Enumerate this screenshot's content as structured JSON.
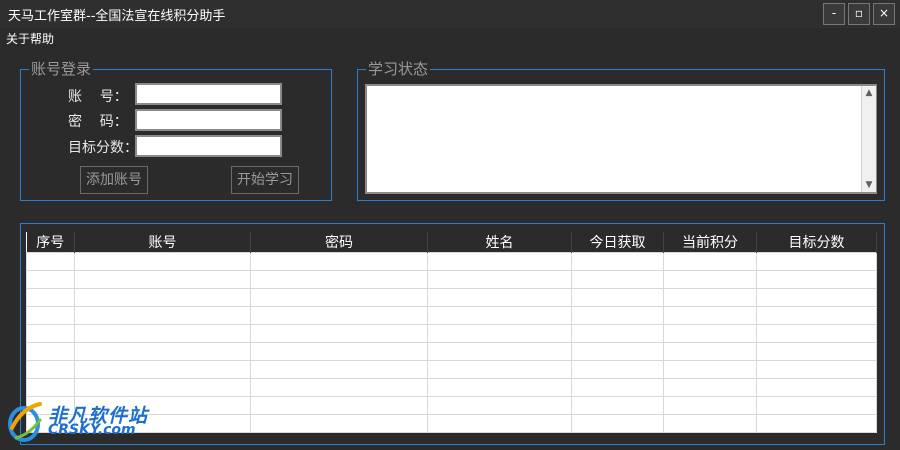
{
  "window": {
    "title": "天马工作室群--全国法宣在线积分助手",
    "controls": {
      "minimize": "-",
      "maximize": "▫",
      "close": "×"
    }
  },
  "menu": {
    "items": [
      "关于帮助"
    ]
  },
  "login": {
    "group_title": "账号登录",
    "account_label": "账    号：",
    "password_label": "密    码：",
    "target_label": "目标分数：",
    "account_value": "",
    "password_value": "",
    "target_value": "",
    "add_button": "添加账号",
    "start_button": "开始学习"
  },
  "status": {
    "group_title": "学习状态",
    "log_text": ""
  },
  "table": {
    "columns": [
      "序号",
      "账号",
      "密码",
      "姓名",
      "今日获取",
      "当前积分",
      "目标分数"
    ],
    "rows": []
  },
  "watermark": {
    "cn": "非凡软件站",
    "en": "CRSKY.com"
  },
  "colors": {
    "accent": "#2d7ecf",
    "background": "#2b2b2b",
    "logo": "#1c6fcf"
  }
}
